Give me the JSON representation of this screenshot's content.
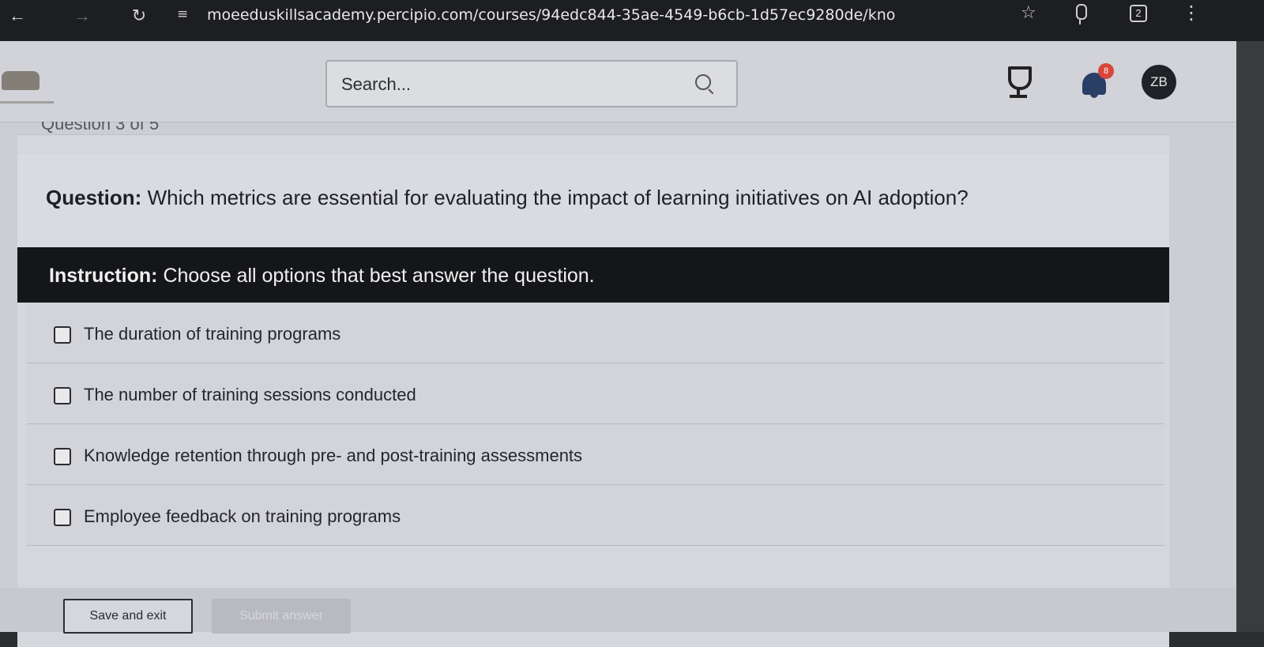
{
  "browser": {
    "url": "moeeduskillsacademy.percipio.com/courses/94edc844-35ae-4549-b6cb-1d57ec9280de/kno",
    "tab_count": "2"
  },
  "header": {
    "search_placeholder": "Search...",
    "notification_count": "8",
    "avatar_initials": "ZB"
  },
  "quiz": {
    "question_counter": "Question 3 of 5",
    "question_label": "Question:",
    "question_text": " Which metrics are essential for evaluating the impact of learning initiatives on AI adoption?",
    "instruction_label": "Instruction:",
    "instruction_text": " Choose all options that best answer the question.",
    "options": [
      {
        "label": "The duration of training programs",
        "checked": false
      },
      {
        "label": "The number of training sessions conducted",
        "checked": false
      },
      {
        "label": "Knowledge retention through pre- and post-training assessments",
        "checked": false
      },
      {
        "label": "Employee feedback on training programs",
        "checked": false
      }
    ]
  },
  "footer": {
    "save_label": "Save and exit",
    "submit_label": "Submit answer"
  },
  "icons": {
    "back": "arrow-left-icon",
    "forward": "arrow-right-icon",
    "reload": "reload-icon",
    "site_info": "tune-icon",
    "bookmark": "star-icon",
    "voice": "microphone-icon",
    "menu": "kebab-menu-icon",
    "search": "search-icon",
    "achievements": "trophy-icon",
    "notifications": "bell-icon"
  },
  "colors": {
    "instruction_bar": "#151619",
    "notification_badge": "#d8453b",
    "avatar_bg": "#202227"
  }
}
